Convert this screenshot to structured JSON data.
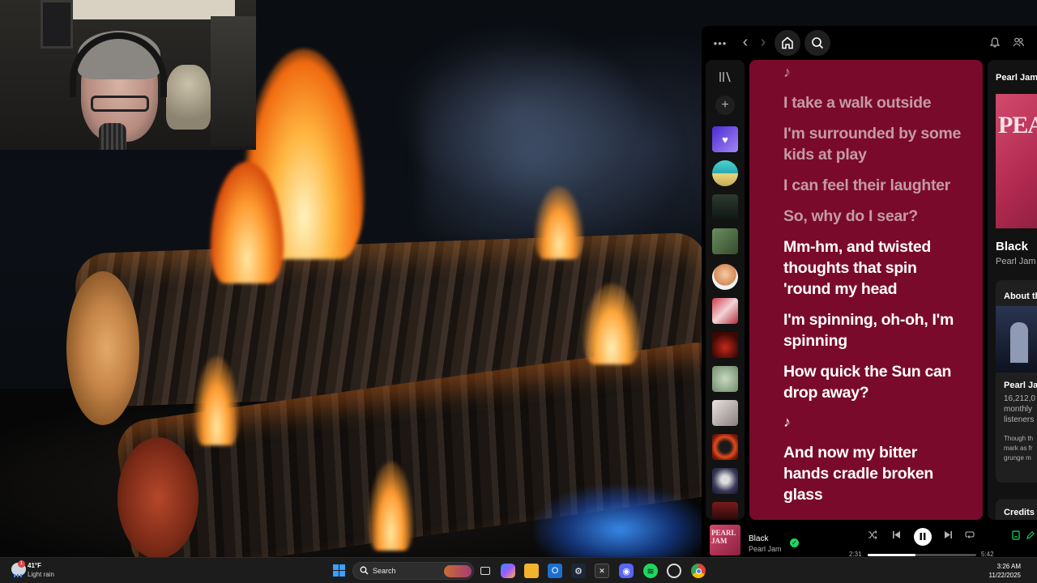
{
  "weather": {
    "temp": "41°F",
    "desc": "Light rain",
    "badge": "1"
  },
  "taskbar": {
    "search_label": "Search",
    "time": "3:26 AM",
    "date": "11/22/2025"
  },
  "spotify": {
    "nav": {
      "menu": "•••",
      "back": "‹",
      "forward": "›"
    },
    "lyrics": [
      {
        "text": "♪",
        "state": "note"
      },
      {
        "text": "I take a walk outside",
        "state": "past"
      },
      {
        "text": "I'm surrounded by some kids at play",
        "state": "past"
      },
      {
        "text": "I can feel their laughter",
        "state": "past"
      },
      {
        "text": "So, why do I sear?",
        "state": "past"
      },
      {
        "text": "Mm-hm, and twisted thoughts that spin 'round my head",
        "state": "active"
      },
      {
        "text": "I'm spinning, oh-oh, I'm spinning",
        "state": "future"
      },
      {
        "text": "How quick the Sun can drop away?",
        "state": "future"
      },
      {
        "text": "♪",
        "state": "note"
      },
      {
        "text": "And now my bitter hands cradle broken glass",
        "state": "future"
      }
    ],
    "now_playing_panel": {
      "artist_header": "Pearl Jam",
      "cover_text": "PEAR",
      "track_title": "Black",
      "track_artist": "Pearl Jam",
      "about_label": "About th",
      "about_name": "Pearl Jam",
      "monthly_listeners_number": "16,212,0",
      "monthly_word": "monthly",
      "listeners_word": "listeners",
      "about_desc_line1": "Though th",
      "about_desc_line2": "mark as fr",
      "about_desc_line3": "grunge m",
      "credits_label": "Credits"
    },
    "player": {
      "cover_text": "PEARL JAM",
      "title": "Black",
      "artist": "Pearl Jam",
      "elapsed": "2:31",
      "total": "5:42",
      "progress": 0.44
    }
  }
}
